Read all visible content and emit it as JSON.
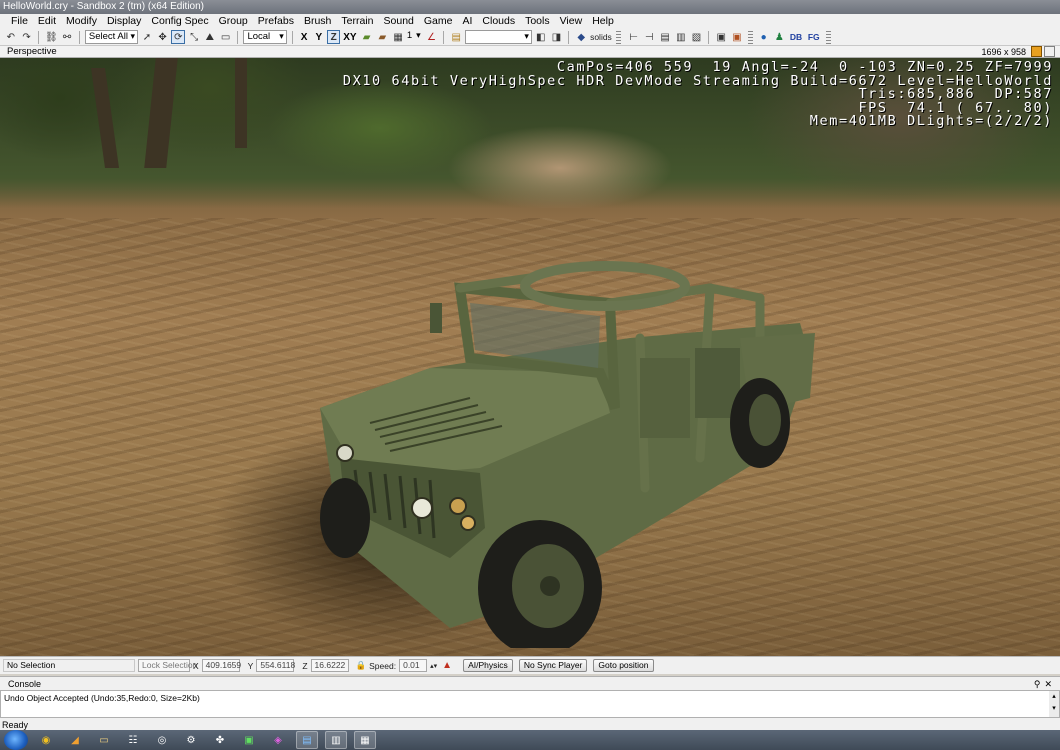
{
  "window": {
    "title": "HelloWorld.cry - Sandbox 2 (tm) (x64 Edition)"
  },
  "menu": [
    "File",
    "Edit",
    "Modify",
    "Display",
    "Config Spec",
    "Group",
    "Prefabs",
    "Brush",
    "Terrain",
    "Sound",
    "Game",
    "AI",
    "Clouds",
    "Tools",
    "View",
    "Help"
  ],
  "toolbar": {
    "select_all": "Select All",
    "coord_system": "Local",
    "axis": [
      "X",
      "Y",
      "Z",
      "XY"
    ],
    "active_axis": "Z",
    "snap_value": "1",
    "render_mode": "solids",
    "db_label": "DB",
    "fg_label": "FG"
  },
  "viewport": {
    "name": "Perspective",
    "resolution": "1696 x 958",
    "hud": [
      "CamPos=406 559  19 Angl=-24  0 -103 ZN=0.25 ZF=7999",
      "DX10 64bit VeryHighSpec HDR DevMode Streaming Build=6672 Level=HelloWorld",
      "Tris:685,886  DP:587",
      "FPS  74.1 ( 67.. 80)",
      "Mem=401MB DLights=(2/2/2)"
    ]
  },
  "status": {
    "selection": "No Selection",
    "lock_selection": "Lock Selection",
    "x_label": "X",
    "x_value": "409.1659",
    "y_label": "Y",
    "y_value": "554.6118",
    "z_label": "Z",
    "z_value": "16.6222",
    "speed_label": "Speed:",
    "speed_value": "0.01",
    "ai_physics": "AI/Physics",
    "no_sync_player": "No Sync Player",
    "goto_position": "Goto position"
  },
  "console": {
    "title": "Console",
    "log": "Undo Object Accepted (Undo:35,Redo:0, Size=2Kb)",
    "status": "Ready"
  },
  "colors": {
    "title_bar": "#6d727b",
    "taskbar": "#3f4a57",
    "active_axis_border": "#3a6ea5"
  }
}
